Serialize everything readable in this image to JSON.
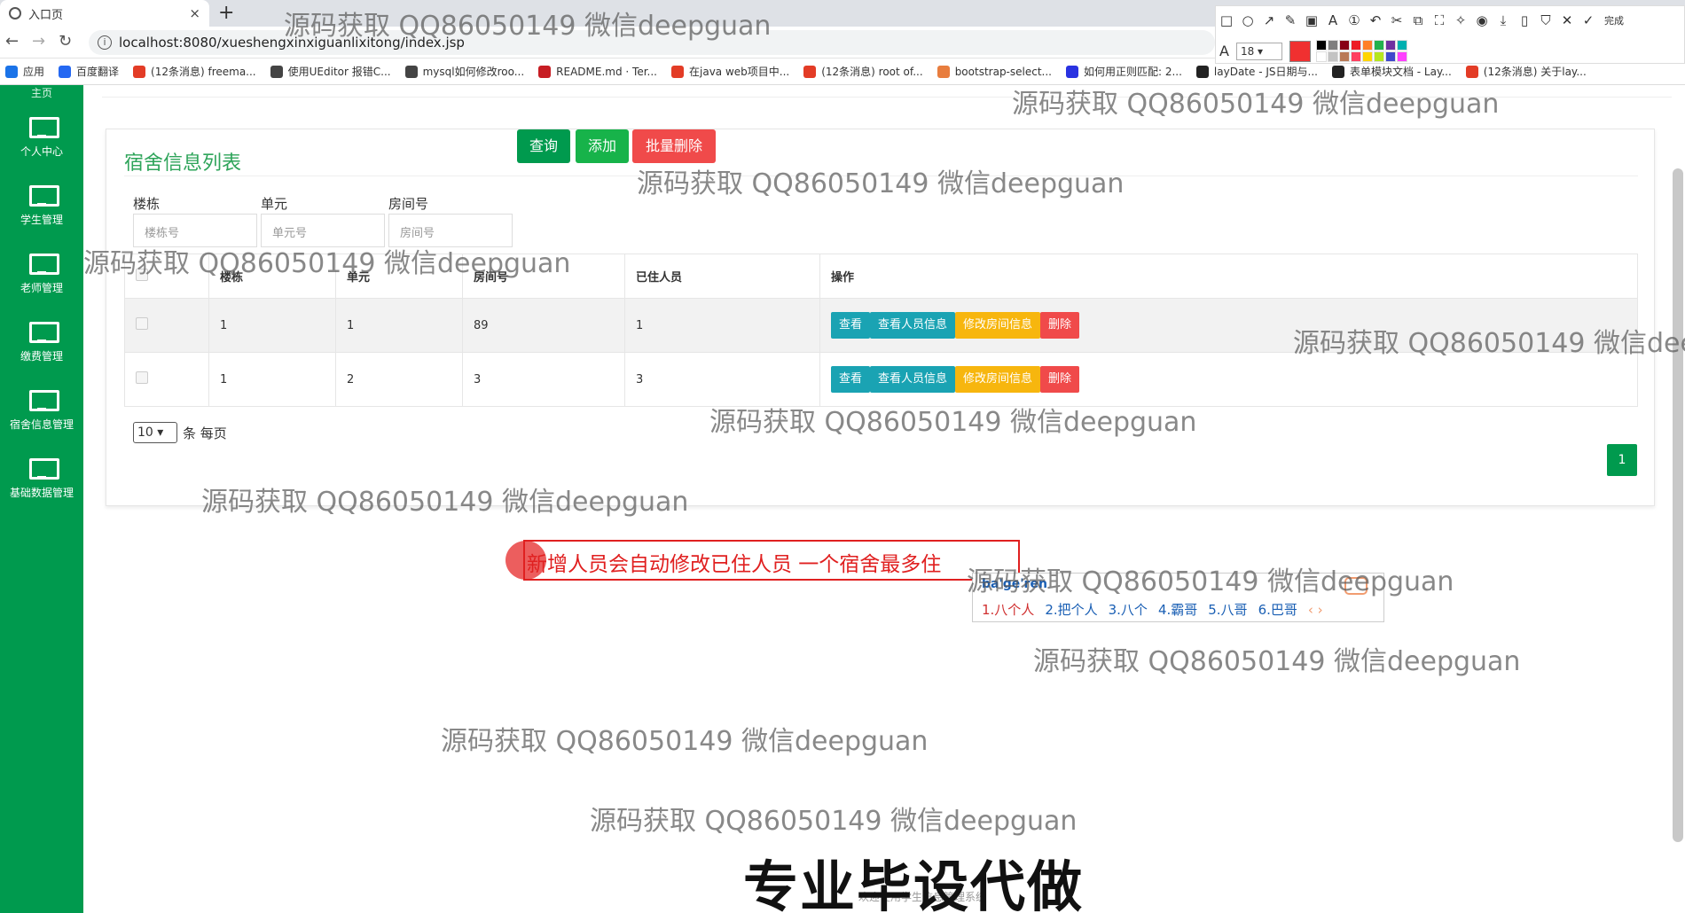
{
  "browser": {
    "tab_title": "入口页",
    "tab_close": "×",
    "new_tab": "+",
    "url": "localhost:8080/xueshengxinxiguanlixitong/index.jsp",
    "bookmarks": [
      {
        "label": "应用",
        "icon": "apps-grid-icon",
        "color": "#1a73e8"
      },
      {
        "label": "百度翻译",
        "icon": "baidu-fanyi-icon",
        "color": "#2468f2"
      },
      {
        "label": "(12条消息) freema...",
        "icon": "csdn-icon",
        "color": "#e33c26"
      },
      {
        "label": "使用UEditor 报错C...",
        "icon": "spider-icon",
        "color": "#444444"
      },
      {
        "label": "mysql如何修改roo...",
        "icon": "spider-icon",
        "color": "#444444"
      },
      {
        "label": "README.md · Ter...",
        "icon": "gitee-icon",
        "color": "#c71d23"
      },
      {
        "label": "在java web项目中...",
        "icon": "csdn-icon",
        "color": "#e33c26"
      },
      {
        "label": "(12条消息) root of...",
        "icon": "csdn-icon",
        "color": "#e33c26"
      },
      {
        "label": "bootstrap-select...",
        "icon": "bootstrap-icon",
        "color": "#e87d3e"
      },
      {
        "label": "如何用正则匹配: 2...",
        "icon": "baidu-paw-icon",
        "color": "#2932e1"
      },
      {
        "label": "layDate - JS日期与...",
        "icon": "layui-icon",
        "color": "#222222"
      },
      {
        "label": "表单模块文档 - Lay...",
        "icon": "layui-icon",
        "color": "#222222"
      },
      {
        "label": "(12条消息) 关于lay...",
        "icon": "csdn-icon",
        "color": "#e33c26"
      }
    ]
  },
  "shot_toolbar": {
    "icons": [
      "rect-icon",
      "circle-icon",
      "arrow-icon",
      "pen-icon",
      "mosaic-icon",
      "text-icon",
      "serial-icon",
      "undo-icon",
      "pin-icon",
      "copy-icon",
      "crop-icon",
      "wand-icon",
      "record-icon",
      "download-icon",
      "phone-icon",
      "bookmark-icon",
      "close-icon",
      "check-icon"
    ],
    "glyphs": [
      "□",
      "○",
      "↗",
      "✎",
      "▣",
      "A",
      "①",
      "↶",
      "✂",
      "⧉",
      "⛶",
      "✧",
      "◉",
      "⤓",
      "▯",
      "⛉",
      "✕",
      "✓"
    ],
    "done_label": "完成",
    "font_size": "18",
    "active_color": "#f03030",
    "palette": [
      "#000000",
      "#7f7f7f",
      "#880015",
      "#ed1c24",
      "#ff7f27",
      "#22b14c",
      "#7030a0",
      "#00b0b0",
      "#ffffff",
      "#c3c3c3",
      "#b97a57",
      "#ff4060",
      "#ffd500",
      "#b5e61d",
      "#3f48cc",
      "#ff40ff"
    ]
  },
  "sidebar": {
    "top_label": "主页",
    "items": [
      {
        "label": "个人中心"
      },
      {
        "label": "学生管理"
      },
      {
        "label": "老师管理"
      },
      {
        "label": "缴费管理"
      },
      {
        "label": "宿舍信息管理"
      },
      {
        "label": "基础数据管理"
      }
    ]
  },
  "panel": {
    "title": "宿舍信息列表",
    "filters": [
      {
        "label": "楼栋",
        "placeholder": "楼栋号"
      },
      {
        "label": "单元",
        "placeholder": "单元号"
      },
      {
        "label": "房间号",
        "placeholder": "房间号"
      }
    ],
    "buttons": {
      "query": "查询",
      "add": "添加",
      "batch_delete": "批量删除"
    },
    "columns": [
      "楼栋",
      "单元",
      "房间号",
      "已住人员",
      "操作"
    ],
    "rows": [
      {
        "building": "1",
        "unit": "1",
        "room": "89",
        "occupants": "1"
      },
      {
        "building": "1",
        "unit": "2",
        "room": "3",
        "occupants": "3"
      }
    ],
    "row_actions": {
      "view": "查看",
      "view_people": "查看人员信息",
      "edit_room": "修改房间信息",
      "delete": "删除"
    },
    "page_size": "10",
    "page_size_suffix": "条 每页",
    "current_page": "1"
  },
  "annotation": {
    "text": "新增人员会自动修改已住人员   一个宿舍最多住"
  },
  "ime": {
    "composition": "ba'ge'ren",
    "candidates": [
      "1.八个人",
      "2.把个人",
      "3.八个",
      "4.霸哥",
      "5.八哥",
      "6.巴哥"
    ],
    "nav": "‹ ›"
  },
  "footer": {
    "ad": "专业毕设代做",
    "small": "欢迎使用学生信息管理系统"
  },
  "watermark": "源码获取 QQ86050149 微信deepguan",
  "colors": {
    "primary_green": "#009a4e",
    "title_green": "#2ea45a",
    "query_btn": "#009a4e",
    "add_btn": "#17b34a",
    "batch_delete_btn": "#f04a4a",
    "view_btn": "#1aa3b3",
    "edit_btn": "#f7b60e",
    "delete_btn": "#f04a4a",
    "annotation_red": "#e02020"
  }
}
